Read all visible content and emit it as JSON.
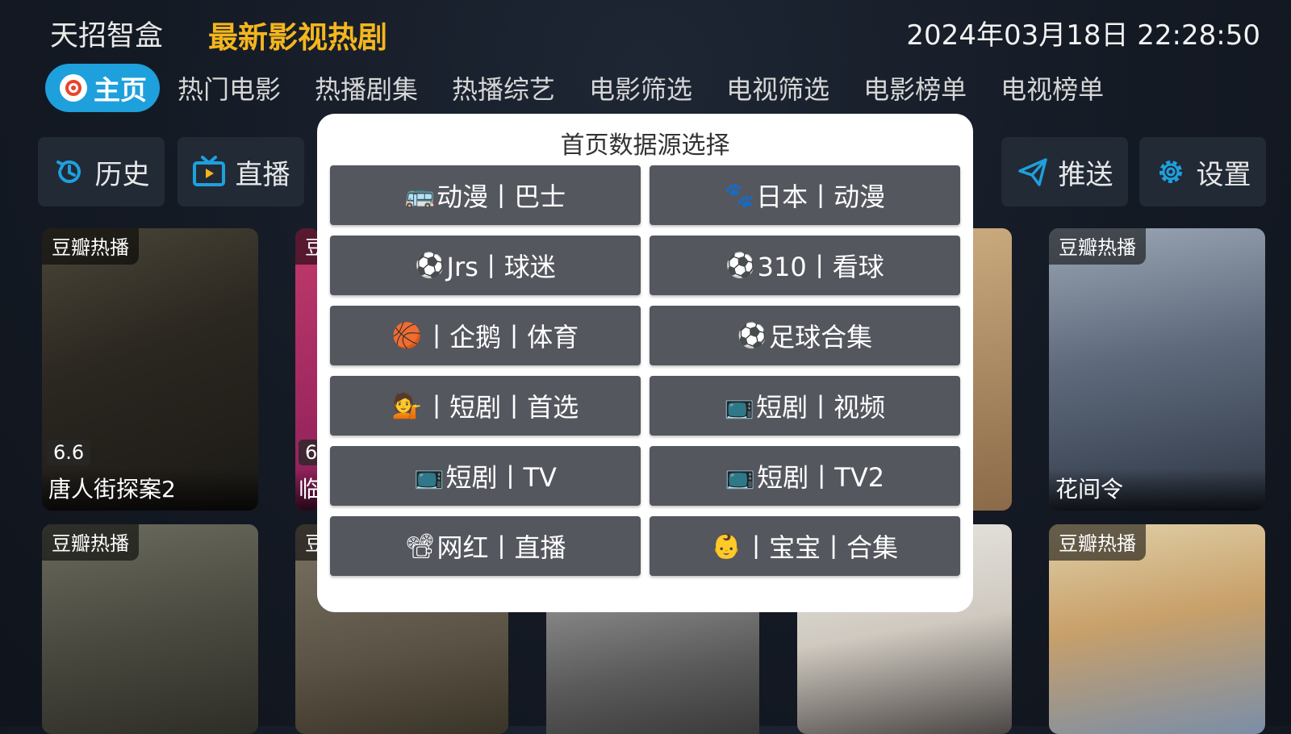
{
  "header": {
    "app_name": "天招智盒",
    "slogan": "最新影视热剧",
    "datetime": "2024年03月18日 22:28:50"
  },
  "nav": {
    "home": "主页",
    "items": [
      "热门电影",
      "热播剧集",
      "热播综艺",
      "电影筛选",
      "电视筛选",
      "电影榜单",
      "电视榜单"
    ]
  },
  "toolbar": {
    "history": "历史",
    "live": "直播",
    "push": "推送",
    "settings": "设置"
  },
  "posters": [
    {
      "tag": "豆瓣热播",
      "score": "6.6",
      "title": "唐人街探案2"
    },
    {
      "tag": "豆",
      "score": "6.",
      "title": "临"
    },
    {
      "tag": "豆瓣热播",
      "title": "花间令"
    },
    {
      "tag": "豆瓣热播"
    },
    {
      "tag": "豆"
    },
    {
      "tag": "豆瓣热播"
    }
  ],
  "dialog": {
    "title": "首页数据源选择",
    "options": [
      {
        "icon": "🚌",
        "label": "动漫丨巴士"
      },
      {
        "icon": "🐾",
        "label": "日本丨动漫"
      },
      {
        "icon": "⚽",
        "label": " Jrs丨球迷"
      },
      {
        "icon": "⚽",
        "label": "310丨看球"
      },
      {
        "icon": "🏀",
        "label": "丨企鹅丨体育"
      },
      {
        "icon": "⚽",
        "label": "足球合集"
      },
      {
        "icon": "💁",
        "label": "丨短剧丨首选"
      },
      {
        "icon": "📺",
        "label": "短剧丨视频"
      },
      {
        "icon": "📺",
        "label": "短剧丨TV"
      },
      {
        "icon": "📺",
        "label": "短剧丨TV2"
      },
      {
        "icon": "📽",
        "label": "网红丨直播"
      },
      {
        "icon": "👶",
        "label": "丨宝宝丨合集"
      }
    ]
  },
  "colors": {
    "accent": "#1ea0dd",
    "slogan": "#f4b61d",
    "option_bg": "#55575f",
    "background": "#141a24"
  }
}
